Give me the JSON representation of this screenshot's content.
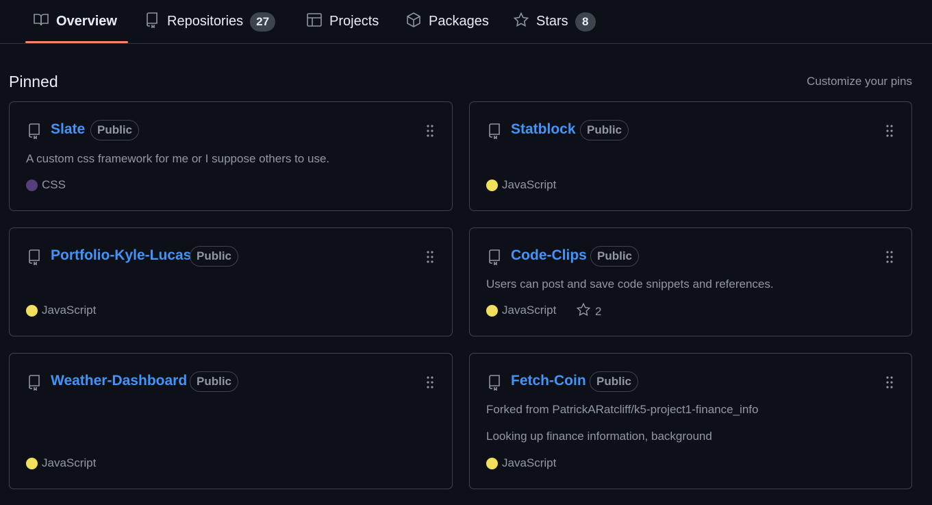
{
  "nav": {
    "tabs": [
      {
        "label": "Overview",
        "icon": "book-icon"
      },
      {
        "label": "Repositories",
        "icon": "repo-icon",
        "count": "27"
      },
      {
        "label": "Projects",
        "icon": "table-icon"
      },
      {
        "label": "Packages",
        "icon": "package-icon"
      },
      {
        "label": "Stars",
        "icon": "star-icon",
        "count": "8"
      }
    ],
    "active_underline_color": "#f78166"
  },
  "pinned": {
    "title": "Pinned",
    "customize_label": "Customize your pins",
    "cards": [
      {
        "name": "Slate",
        "visibility": "Public",
        "description": "A custom css framework for me or I suppose others to use.",
        "language": "CSS",
        "language_color": "#563d7c"
      },
      {
        "name": "Statblock",
        "visibility": "Public",
        "language": "JavaScript",
        "language_color": "#f1e05a"
      },
      {
        "name": "Portfolio-Kyle-Lucas",
        "visibility": "Public",
        "language": "JavaScript",
        "language_color": "#f1e05a"
      },
      {
        "name": "Code-Clips",
        "visibility": "Public",
        "description": "Users can post and save code snippets and references.",
        "language": "JavaScript",
        "language_color": "#f1e05a",
        "stars": "2"
      },
      {
        "name": "Weather-Dashboard",
        "visibility": "Public",
        "language": "JavaScript",
        "language_color": "#f1e05a"
      },
      {
        "name": "Fetch-Coin",
        "visibility": "Public",
        "forked_from": "Forked from PatrickARatcliff/k5-project1-finance_info",
        "description": "Looking up finance information, background",
        "language": "JavaScript",
        "language_color": "#f1e05a"
      }
    ]
  },
  "colors": {
    "background": "#0d1117",
    "link": "#4493f8",
    "border": "#3d444d",
    "muted_text": "#9198a1"
  }
}
